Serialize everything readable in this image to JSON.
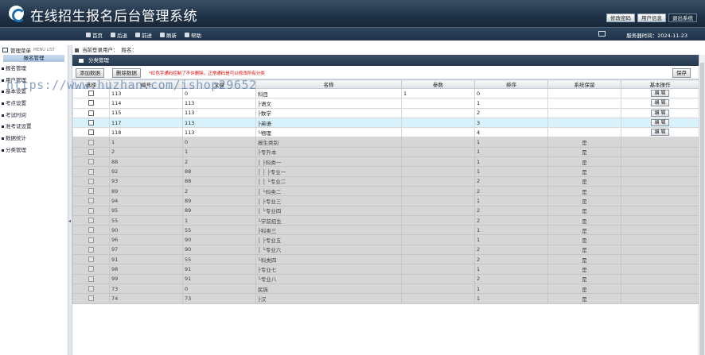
{
  "header": {
    "title": "在线招生报名后台管理系统",
    "buttons": [
      "修改密码",
      "用户信息",
      "退出系统"
    ]
  },
  "nav": {
    "items": [
      {
        "label": "首页",
        "icon": "home-icon"
      },
      {
        "label": "后退",
        "icon": "back-arrow-icon"
      },
      {
        "label": "前进",
        "icon": "forward-arrow-icon"
      },
      {
        "label": "刷新",
        "icon": "refresh-icon"
      },
      {
        "label": "帮助",
        "icon": "help-icon"
      }
    ],
    "server_time": "服务器时间：2024-11-23"
  },
  "sidebar": {
    "head_label": "管理菜单",
    "head_sub": "MENU LIST",
    "section": "报名管理",
    "items": [
      "报名管理",
      "用户管理",
      "基本设置",
      "考点设置",
      "考试时间",
      "准考证设置",
      "数据统计",
      "分类管理"
    ]
  },
  "userbar": {
    "label": "当前登录用户：",
    "name_label": "姓名："
  },
  "panel": {
    "title": "分类管理",
    "add_button": "添加数据",
    "delete_button": "删除数据",
    "warning": "*红色字通码控制了不许删除，正常通码是可以修改所有分类",
    "save_button": "保存"
  },
  "table": {
    "headers": [
      "选择",
      "编号",
      "父级",
      "名称",
      "参数",
      "排序",
      "系统保留",
      "基本操作"
    ],
    "edit_label": "编 辑",
    "rows": [
      {
        "style": "white",
        "id": "113",
        "parent": "0",
        "name": "科目",
        "param": "1",
        "order": "0",
        "sys": "",
        "edit": true
      },
      {
        "style": "white",
        "id": "114",
        "parent": "113",
        "name": "├语文",
        "param": "",
        "order": "1",
        "sys": "",
        "edit": true
      },
      {
        "style": "white",
        "id": "115",
        "parent": "113",
        "name": "├数学",
        "param": "",
        "order": "2",
        "sys": "",
        "edit": true
      },
      {
        "style": "hl",
        "id": "117",
        "parent": "113",
        "name": "├英语",
        "param": "",
        "order": "3",
        "sys": "",
        "edit": true
      },
      {
        "style": "white",
        "id": "118",
        "parent": "113",
        "name": "└物理",
        "param": "",
        "order": "4",
        "sys": "",
        "edit": true
      },
      {
        "style": "grey",
        "id": "1",
        "parent": "0",
        "name": "报生类别",
        "param": "",
        "order": "1",
        "sys": "是",
        "edit": false
      },
      {
        "style": "grey",
        "id": "2",
        "parent": "1",
        "name": "├专升本",
        "param": "",
        "order": "1",
        "sys": "是",
        "edit": false
      },
      {
        "style": "grey",
        "id": "88",
        "parent": "2",
        "name": "│ ├科类一",
        "param": "",
        "order": "1",
        "sys": "是",
        "edit": false
      },
      {
        "style": "grey",
        "id": "92",
        "parent": "88",
        "name": "│ │ ├专业一",
        "param": "",
        "order": "1",
        "sys": "是",
        "edit": false
      },
      {
        "style": "grey",
        "id": "93",
        "parent": "88",
        "name": "│ │ └专业二",
        "param": "",
        "order": "2",
        "sys": "是",
        "edit": false
      },
      {
        "style": "grey",
        "id": "89",
        "parent": "2",
        "name": "│ └科类二",
        "param": "",
        "order": "2",
        "sys": "是",
        "edit": false
      },
      {
        "style": "grey",
        "id": "94",
        "parent": "89",
        "name": "│ ├专业三",
        "param": "",
        "order": "1",
        "sys": "是",
        "edit": false
      },
      {
        "style": "grey",
        "id": "95",
        "parent": "89",
        "name": "│ └专业四",
        "param": "",
        "order": "2",
        "sys": "是",
        "edit": false
      },
      {
        "style": "grey",
        "id": "55",
        "parent": "1",
        "name": "└学前招生",
        "param": "",
        "order": "2",
        "sys": "是",
        "edit": false
      },
      {
        "style": "grey",
        "id": "90",
        "parent": "55",
        "name": "├科类三",
        "param": "",
        "order": "1",
        "sys": "是",
        "edit": false
      },
      {
        "style": "grey",
        "id": "96",
        "parent": "90",
        "name": "│ ├专业五",
        "param": "",
        "order": "1",
        "sys": "是",
        "edit": false
      },
      {
        "style": "grey",
        "id": "97",
        "parent": "90",
        "name": "│ └专业六",
        "param": "",
        "order": "2",
        "sys": "是",
        "edit": false
      },
      {
        "style": "grey",
        "id": "91",
        "parent": "55",
        "name": "└科类四",
        "param": "",
        "order": "2",
        "sys": "是",
        "edit": false
      },
      {
        "style": "grey",
        "id": "98",
        "parent": "91",
        "name": "├专业七",
        "param": "",
        "order": "1",
        "sys": "是",
        "edit": false
      },
      {
        "style": "grey",
        "id": "99",
        "parent": "91",
        "name": "└专业八",
        "param": "",
        "order": "2",
        "sys": "是",
        "edit": false
      },
      {
        "style": "grey",
        "id": "73",
        "parent": "0",
        "name": "民族",
        "param": "",
        "order": "1",
        "sys": "是",
        "edit": false
      },
      {
        "style": "grey",
        "id": "74",
        "parent": "73",
        "name": "├汉",
        "param": "",
        "order": "1",
        "sys": "是",
        "edit": false
      }
    ]
  },
  "watermark": "https://www.huzhan.com/ishop29652"
}
